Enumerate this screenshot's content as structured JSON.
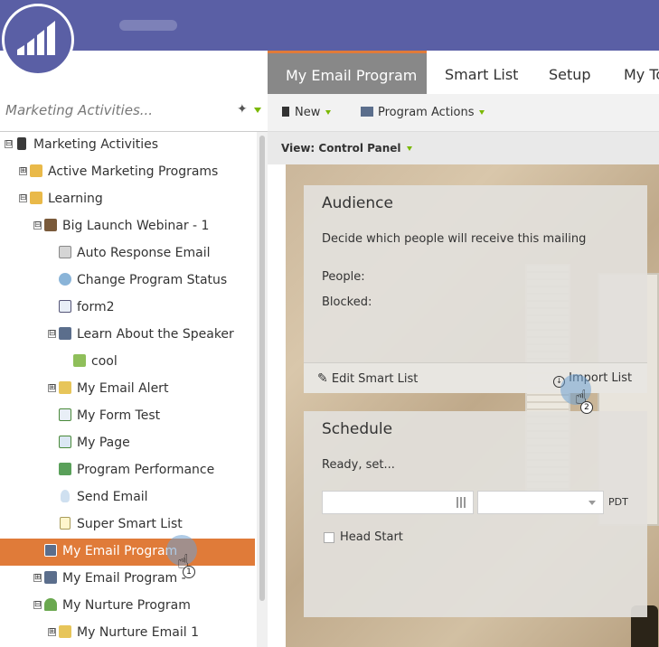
{
  "header": {
    "logo_icon": "marketo-bars-icon"
  },
  "tabs": [
    {
      "label": "My Email Program",
      "active": true
    },
    {
      "label": "Smart List"
    },
    {
      "label": "Setup"
    },
    {
      "label": "My To"
    }
  ],
  "left_panel": {
    "search_placeholder": "Marketing Activities...",
    "tree": [
      {
        "label": "Marketing Activities",
        "exp": "⊟",
        "icon": "doc-book"
      },
      {
        "label": "Active Marketing Programs",
        "exp": "⊞",
        "icon": "folder"
      },
      {
        "label": "Learning",
        "exp": "⊟",
        "icon": "folder"
      },
      {
        "label": "Big Launch Webinar - 1",
        "exp": "⊟",
        "icon": "event-program"
      },
      {
        "label": "Auto Response Email",
        "icon": "email"
      },
      {
        "label": "Change Program Status",
        "icon": "status"
      },
      {
        "label": "form2",
        "icon": "form"
      },
      {
        "label": "Learn About the Speaker",
        "exp": "⊟",
        "icon": "email-program"
      },
      {
        "label": "cool",
        "icon": "smart-campaign"
      },
      {
        "label": "My Email Alert",
        "exp": "⊞",
        "icon": "email-alert"
      },
      {
        "label": "My Form Test",
        "icon": "form-test"
      },
      {
        "label": "My Page",
        "icon": "landing-page"
      },
      {
        "label": "Program Performance",
        "icon": "report"
      },
      {
        "label": "Send Email",
        "icon": "bulb"
      },
      {
        "label": "Super Smart List",
        "icon": "smart-list"
      },
      {
        "label": "My Email Program",
        "selected": true,
        "icon": "email-program"
      },
      {
        "label": "My Email Program -",
        "exp": "⊞",
        "icon": "email-program"
      },
      {
        "label": "My Nurture Program",
        "exp": "⊟",
        "icon": "nurture"
      },
      {
        "label": "My Nurture Email 1",
        "exp": "⊞",
        "icon": "email"
      }
    ]
  },
  "toolbar": {
    "new_label": "New",
    "program_actions_label": "Program Actions"
  },
  "view": {
    "label": "View: Control Panel"
  },
  "audience": {
    "title": "Audience",
    "desc": "Decide which people will receive this mailing",
    "people_label": "People:",
    "blocked_label": "Blocked:",
    "edit_smart_list": "Edit Smart List",
    "import_list": "Import List"
  },
  "schedule": {
    "title": "Schedule",
    "status": "Ready, set...",
    "timezone": "PDT",
    "head_start": "Head Start"
  },
  "cursors": [
    {
      "step": "1"
    },
    {
      "step": "2"
    }
  ]
}
